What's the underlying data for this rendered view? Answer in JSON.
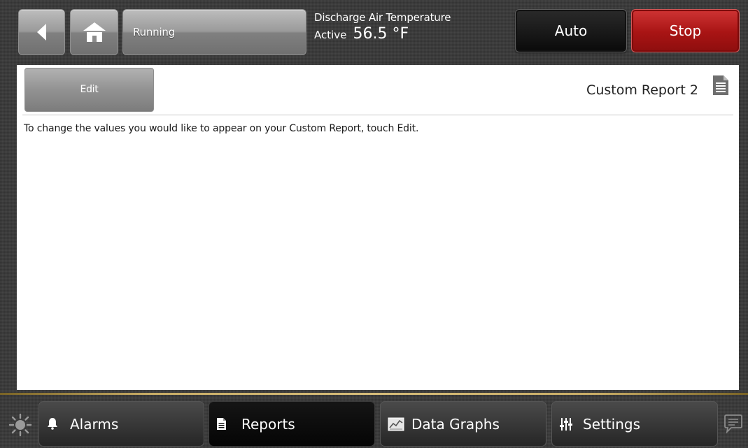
{
  "header": {
    "status": "Running",
    "point_name": "Discharge Air Temperature",
    "point_state": "Active",
    "point_value": "56.5 °F",
    "mode_button": "Auto",
    "stop_button": "Stop",
    "icons": [
      "back-arrow-icon",
      "home-icon"
    ]
  },
  "report": {
    "edit_button": "Edit",
    "title": "Custom Report 2",
    "icon": "document-icon",
    "instructions": "To change the values you would like to appear on your Custom Report, touch Edit."
  },
  "nav": {
    "tabs": [
      {
        "label": "Alarms",
        "icon": "bell-icon",
        "active": false
      },
      {
        "label": "Reports",
        "icon": "document-icon",
        "active": true
      },
      {
        "label": "Data Graphs",
        "icon": "graph-icon",
        "active": false
      },
      {
        "label": "Settings",
        "icon": "sliders-icon",
        "active": false
      }
    ],
    "left_icon": "brightness-icon",
    "right_icon": "chat-icon"
  },
  "colors": {
    "stop_red": "#b01c1c",
    "accent_gold": "#c9ad66",
    "panel_bg": "#ffffff"
  }
}
